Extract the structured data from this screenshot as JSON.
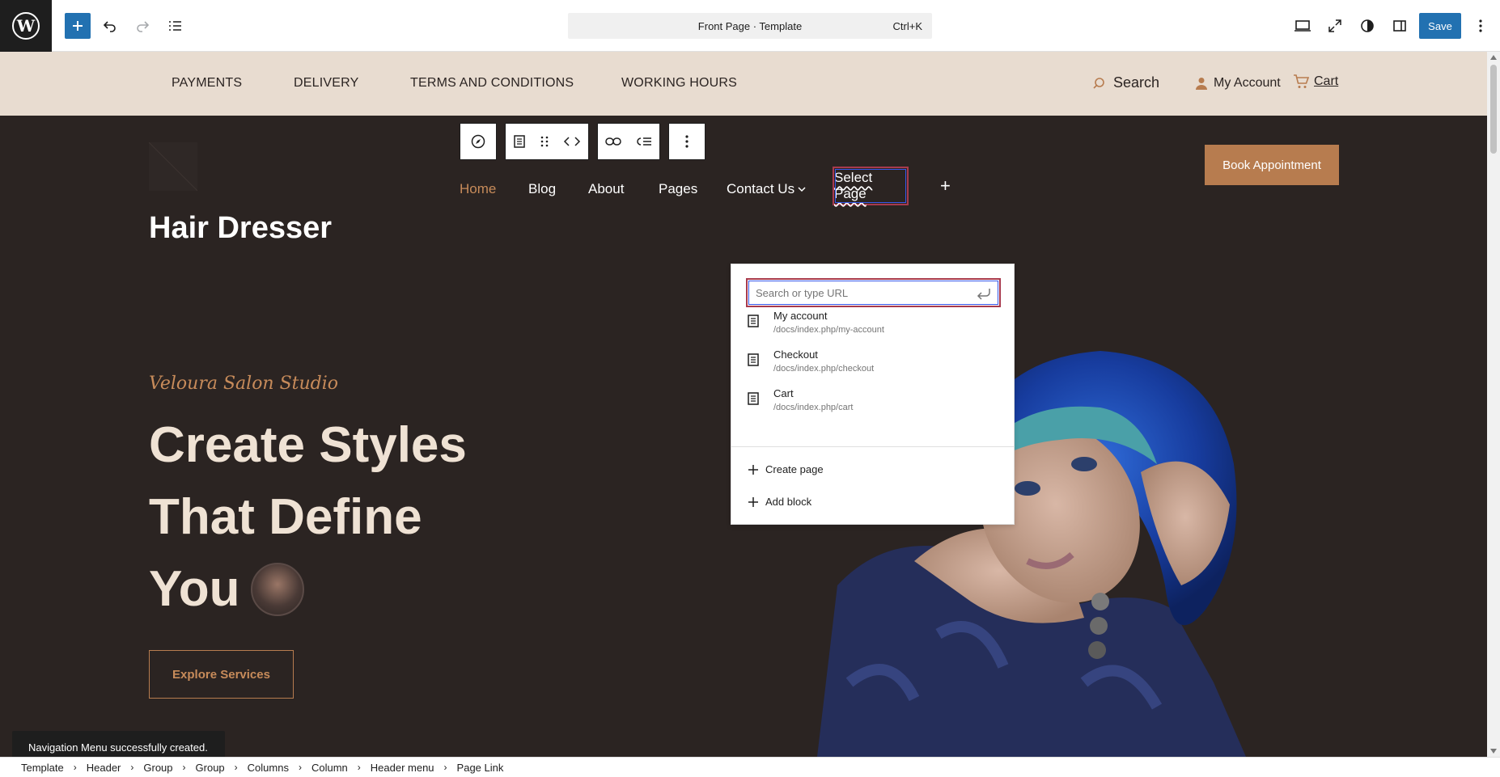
{
  "editor": {
    "document_title": "Front Page · Template",
    "shortcut": "Ctrl+K",
    "save_label": "Save"
  },
  "top_nav": {
    "items": [
      "PAYMENTS",
      "DELIVERY",
      "TERMS AND CONDITIONS",
      "WORKING HOURS"
    ],
    "search_label": "Search",
    "account_label": "My Account",
    "cart_label": "Cart"
  },
  "header": {
    "site_title": "Hair Dresser",
    "nav_items": [
      "Home",
      "Blog",
      "About",
      "Pages",
      "Contact Us"
    ],
    "select_page_label": "Select Page",
    "book_button": "Book Appointment"
  },
  "hero": {
    "subtitle": "Veloura Salon Studio",
    "lines": [
      "Create Styles",
      "That Define",
      "You"
    ],
    "cta": "Explore Services"
  },
  "link_popover": {
    "search_placeholder": "Search or type URL",
    "suggestions": [
      {
        "title": "My account",
        "url": "/docs/index.php/my-account"
      },
      {
        "title": "Checkout",
        "url": "/docs/index.php/checkout"
      },
      {
        "title": "Cart",
        "url": "/docs/index.php/cart"
      }
    ],
    "create_page": "Create page",
    "add_block": "Add block"
  },
  "snackbar": "Navigation Menu successfully created.",
  "breadcrumbs": [
    "Template",
    "Header",
    "Group",
    "Group",
    "Columns",
    "Column",
    "Header menu",
    "Page Link"
  ],
  "colors": {
    "accent": "#2271b1",
    "canvas_bg": "#2b2422",
    "topnav_bg": "#e8dcd0",
    "brand_copper": "#b77c4f",
    "selection_outline": "#a83a4d"
  }
}
